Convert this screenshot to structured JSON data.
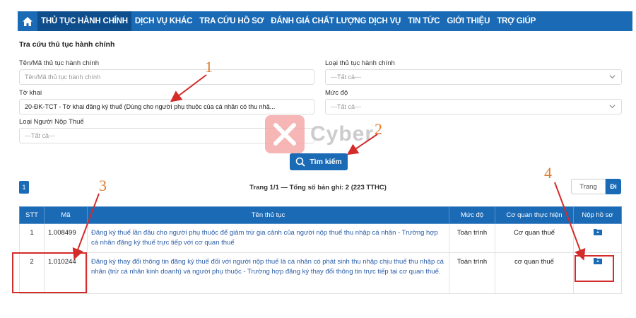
{
  "nav": {
    "items": [
      {
        "label": "THỦ TỤC HÀNH CHÍNH",
        "active": true
      },
      {
        "label": "DỊCH VỤ KHÁC"
      },
      {
        "label": "TRA CỨU HỒ SƠ"
      },
      {
        "label": "ĐÁNH GIÁ CHẤT LƯỢNG DỊCH VỤ"
      },
      {
        "label": "TIN TỨC"
      },
      {
        "label": "GIỚI THIỆU"
      },
      {
        "label": "TRỢ GIÚP"
      }
    ]
  },
  "form": {
    "section_title": "Tra cứu thủ tục hành chính",
    "name_label": "Tên/Mã thủ tục hành chính",
    "name_placeholder": "Tên/Mã thủ tục hành chính",
    "type_label": "Loại thủ tục hành chính",
    "type_value": "---Tất cả---",
    "form_label": "Tờ khai",
    "form_value": "20-ĐK-TCT - Tờ khai đăng ký thuế (Dùng cho người phụ thuộc của cá nhân có thu nhậ...",
    "level_label": "Mức độ",
    "level_value": "---Tất cả---",
    "payer_label": "Loại Người Nộp Thuế",
    "payer_value": "---Tất cả---",
    "search_button": "Tìm kiếm"
  },
  "pagination": {
    "current_page": "1",
    "summary": "Trang 1/1 — Tổng số bản ghi: 2 (223 TTHC)",
    "page_input_placeholder": "Trang",
    "go_button": "Đi"
  },
  "table": {
    "headers": [
      "STT",
      "Mã",
      "Tên thủ tục",
      "Mức độ",
      "Cơ quan thực hiện",
      "Nộp hồ sơ"
    ],
    "rows": [
      {
        "stt": "1",
        "code": "1.008499",
        "name": "Đăng ký thuế lần đầu cho người phụ thuộc để giảm trừ gia cảnh của người nộp thuế thu nhập cá nhân - Trường hợp cá nhân đăng ký thuế trực tiếp với cơ quan thuế",
        "level": "Toàn trình",
        "agency": "Cơ quan thuế"
      },
      {
        "stt": "2",
        "code": "1.010244",
        "name": "Đăng ký thay đổi thông tin đăng ký thuế đối với người nộp thuế là cá nhân có phát sinh thu nhập chịu thuế thu nhập cá nhân (trừ cá nhân kinh doanh) và người phụ thuộc - Trường hợp đăng ký thay đổi thông tin trực tiếp tại cơ quan thuế.",
        "level": "Toàn trình",
        "agency": "cơ quan thuế"
      }
    ]
  },
  "annotations": [
    "1",
    "2",
    "3",
    "4"
  ],
  "watermark": {
    "text": "Cyber"
  },
  "icons": {
    "home": "home-icon",
    "search": "search-icon",
    "submit": "folder-upload-icon",
    "dropdown": "chevron-down-icon"
  },
  "colors": {
    "primary": "#1a6ab5",
    "annotation_box": "#d42b2b",
    "annotation_number": "#e07b2a"
  }
}
